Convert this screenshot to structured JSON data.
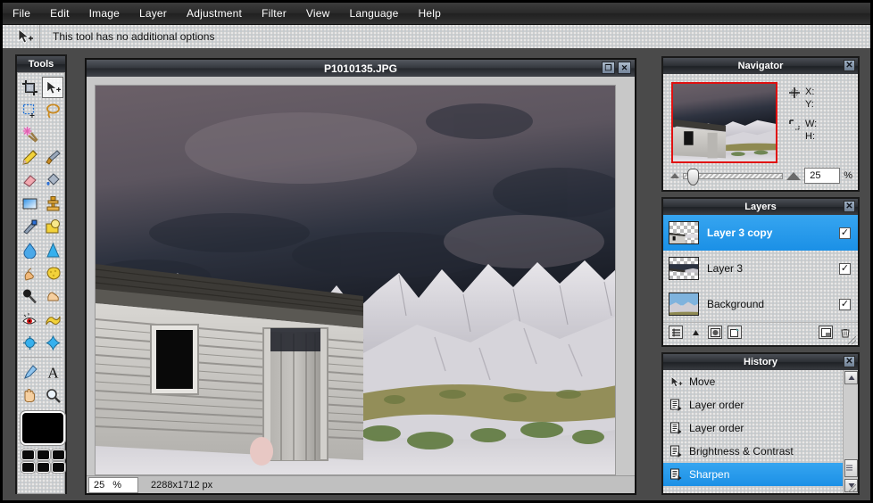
{
  "menubar": {
    "items": [
      {
        "label": "File"
      },
      {
        "label": "Edit"
      },
      {
        "label": "Image"
      },
      {
        "label": "Layer"
      },
      {
        "label": "Adjustment"
      },
      {
        "label": "Filter"
      },
      {
        "label": "View"
      },
      {
        "label": "Language"
      },
      {
        "label": "Help"
      }
    ]
  },
  "options_bar": {
    "tool_icon": "move-tool-icon",
    "text": "This tool has no additional options"
  },
  "tools_panel": {
    "title": "Tools",
    "close_label": "✕",
    "selected_tool": "move",
    "tools": [
      {
        "name": "crop-tool",
        "glyph": "⬚",
        "selected": false
      },
      {
        "name": "move-tool",
        "glyph": "⬈",
        "selected": true
      },
      {
        "name": "rectangle-select-tool",
        "glyph": "▢",
        "selected": false
      },
      {
        "name": "lasso-select-tool",
        "glyph": "◯",
        "selected": false
      },
      {
        "name": "magic-wand-tool",
        "glyph": "✸",
        "selected": false
      },
      {
        "name": "pencil-tool",
        "glyph": "✏",
        "selected": false
      },
      {
        "name": "paintbrush-tool",
        "glyph": "🖌",
        "selected": false
      },
      {
        "name": "eraser-tool",
        "glyph": "▰",
        "selected": false
      },
      {
        "name": "paint-bucket-tool",
        "glyph": "⬤",
        "selected": false
      },
      {
        "name": "gradient-tool",
        "glyph": "▦",
        "selected": false
      },
      {
        "name": "clone-stamp-tool",
        "glyph": "♟",
        "selected": false
      },
      {
        "name": "smudge-tool",
        "glyph": "☂",
        "selected": false
      },
      {
        "name": "shapes-tool",
        "glyph": "⬛",
        "selected": false
      },
      {
        "name": "blur-tool",
        "glyph": "💧",
        "selected": false
      },
      {
        "name": "sharpen-tool",
        "glyph": "▲",
        "selected": false
      },
      {
        "name": "dodge-tool",
        "glyph": "☜",
        "selected": false
      },
      {
        "name": "sponge-tool",
        "glyph": "◈",
        "selected": false
      },
      {
        "name": "burn-tool",
        "glyph": "●",
        "selected": false
      },
      {
        "name": "pinch-tool",
        "glyph": "✋",
        "selected": false
      },
      {
        "name": "red-eye-tool",
        "glyph": "👁",
        "selected": false
      },
      {
        "name": "warp-tool",
        "glyph": "〰",
        "selected": false
      },
      {
        "name": "bulge-tool",
        "glyph": "⬤",
        "selected": false
      },
      {
        "name": "distort-tool",
        "glyph": "✦",
        "selected": false
      },
      {
        "name": "eyedropper-tool",
        "glyph": "⟋",
        "selected": false
      },
      {
        "name": "text-tool",
        "glyph": "A",
        "selected": false
      },
      {
        "name": "hand-tool",
        "glyph": "✋",
        "selected": false
      },
      {
        "name": "zoom-tool",
        "glyph": "🔍",
        "selected": false
      }
    ],
    "foreground_color": "#000000",
    "palette_colors": [
      "#0a0a0a",
      "#0a0a0a",
      "#0a0a0a",
      "#0a0a0a",
      "#0a0a0a",
      "#0a0a0a"
    ]
  },
  "document": {
    "title": "P1010135.JPG",
    "maximize_label": "❐",
    "close_label": "✕",
    "status": {
      "zoom_value": "25",
      "zoom_unit": "%",
      "dimensions": "2288x1712 px"
    }
  },
  "navigator": {
    "title": "Navigator",
    "close_label": "✕",
    "x_label": "X:",
    "y_label": "Y:",
    "w_label": "W:",
    "h_label": "H:",
    "x_value": "",
    "y_value": "",
    "w_value": "",
    "h_value": "",
    "zoom_value": "25",
    "zoom_unit": "%",
    "zoom_out_icon": "triangle-small-icon",
    "zoom_in_icon": "triangle-large-icon",
    "view_marker_color": "#e01010"
  },
  "layers": {
    "title": "Layers",
    "close_label": "✕",
    "selection_color": "#1b90e6",
    "items": [
      {
        "name": "Layer 3 copy",
        "visible": true,
        "selected": true,
        "check": "✓"
      },
      {
        "name": "Layer 3",
        "visible": true,
        "selected": false,
        "check": "✓"
      },
      {
        "name": "Background",
        "visible": true,
        "selected": false,
        "check": "✓"
      }
    ],
    "toolbar": [
      {
        "name": "blend-mode-button",
        "glyph": "▤"
      },
      {
        "name": "move-up-button",
        "glyph": "▲"
      },
      {
        "name": "layer-mask-button",
        "glyph": "◉"
      },
      {
        "name": "new-layer-button",
        "glyph": "❏"
      },
      {
        "name": "duplicate-layer-button",
        "glyph": "◪"
      },
      {
        "name": "delete-layer-button",
        "glyph": "🗑"
      }
    ]
  },
  "history": {
    "title": "History",
    "close_label": "✕",
    "selection_color": "#1b90e6",
    "items": [
      {
        "label": "Move",
        "icon": "move-cursor-icon",
        "glyph": "⬈",
        "selected": false
      },
      {
        "label": "Layer order",
        "icon": "layers-icon",
        "glyph": "▤",
        "selected": false
      },
      {
        "label": "Layer order",
        "icon": "layers-icon",
        "glyph": "▤",
        "selected": false
      },
      {
        "label": "Brightness & Contrast",
        "icon": "layers-icon",
        "glyph": "▤",
        "selected": false
      },
      {
        "label": "Sharpen",
        "icon": "layers-icon",
        "glyph": "▤",
        "selected": true
      }
    ],
    "scroll_up_label": "▲",
    "scroll_down_label": "▼"
  }
}
